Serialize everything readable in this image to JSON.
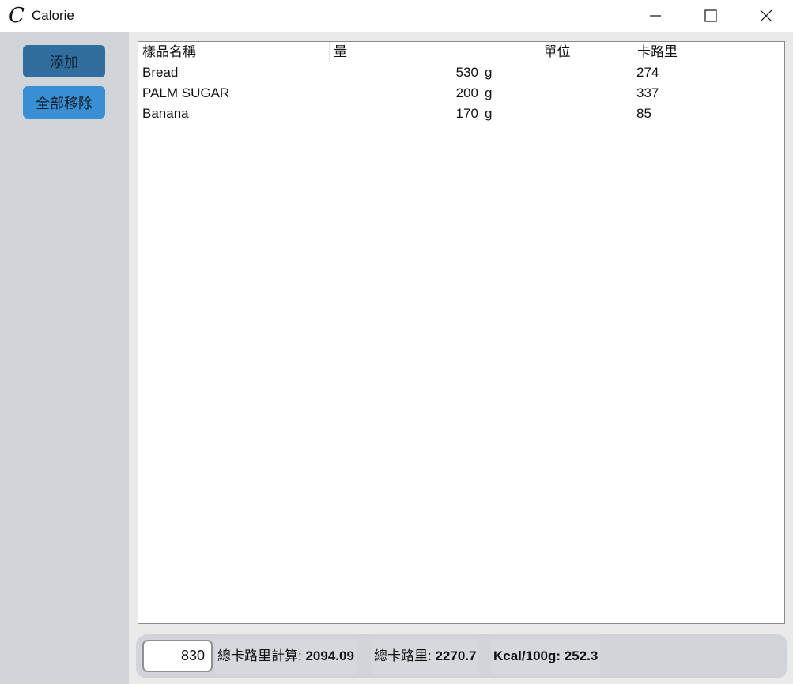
{
  "window": {
    "app_icon": "C",
    "title": "Calorie"
  },
  "sidebar": {
    "add_label": "添加",
    "remove_all_label": "全部移除"
  },
  "list": {
    "columns": [
      "樣品名稱",
      "量",
      "單位",
      "卡路里"
    ],
    "rows": [
      {
        "name": "Bread",
        "amount": "530",
        "unit": "g",
        "calories": "274"
      },
      {
        "name": "PALM SUGAR",
        "amount": "200",
        "unit": "g",
        "calories": "337"
      },
      {
        "name": "Banana",
        "amount": "170",
        "unit": "g",
        "calories": "85"
      }
    ]
  },
  "footer": {
    "weight_value": "830",
    "calc_label": "總卡路里計算: ",
    "calc_value": "2094.09",
    "total_label": "總卡路里: ",
    "total_value": "2270.7",
    "per100_label": "Kcal/100g: ",
    "per100_value": "252.3"
  }
}
